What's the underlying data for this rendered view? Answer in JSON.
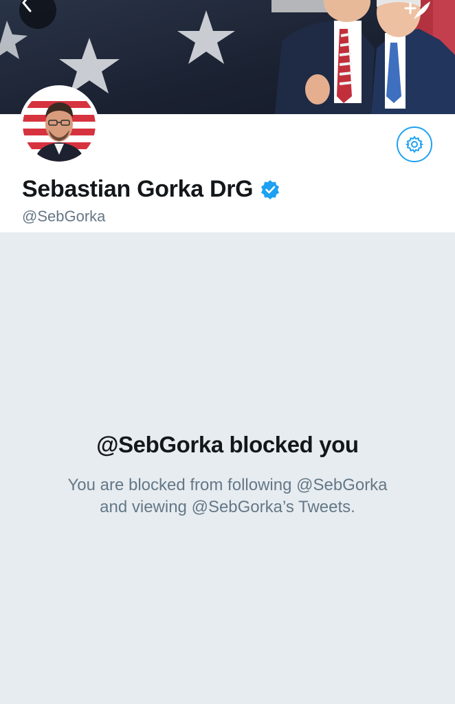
{
  "profile": {
    "display_name": "Sebastian Gorka DrG",
    "handle": "@SebGorka",
    "verified": true
  },
  "header": {
    "back_icon": "chevron-left-icon",
    "compose_icon": "compose-tweet-icon"
  },
  "blocked": {
    "title": "@SebGorka blocked you",
    "line1": "You are blocked from following @SebGorka",
    "line2": "and viewing @SebGorka’s Tweets."
  },
  "colors": {
    "accent": "#1da1f2",
    "background": "#e6ecf0",
    "text_primary": "#14171a",
    "text_secondary": "#657786"
  }
}
